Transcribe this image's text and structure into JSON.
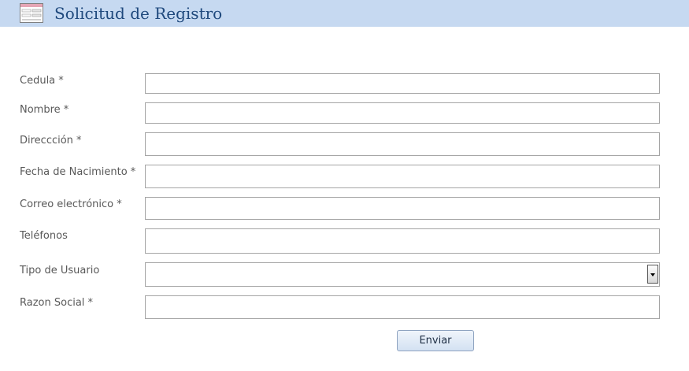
{
  "form": {
    "title": "Solicitud de Registro",
    "fields": [
      {
        "label": "Cedula *",
        "value": ""
      },
      {
        "label": "Nombre *",
        "value": ""
      },
      {
        "label": "Direccción *",
        "value": ""
      },
      {
        "label": "Fecha de Nacimiento *",
        "value": ""
      },
      {
        "label": "Correo electrónico *",
        "value": ""
      },
      {
        "label": "Teléfonos",
        "value": ""
      },
      {
        "label": "Tipo de Usuario",
        "value": ""
      },
      {
        "label": "Razon Social *",
        "value": ""
      }
    ],
    "submit_label": "Enviar"
  },
  "colors": {
    "header_bg": "#c6d9f1",
    "title_text": "#1f497d",
    "label_text": "#595959",
    "field_border": "#a5a5a5"
  },
  "icons": {
    "header": "form-icon"
  }
}
